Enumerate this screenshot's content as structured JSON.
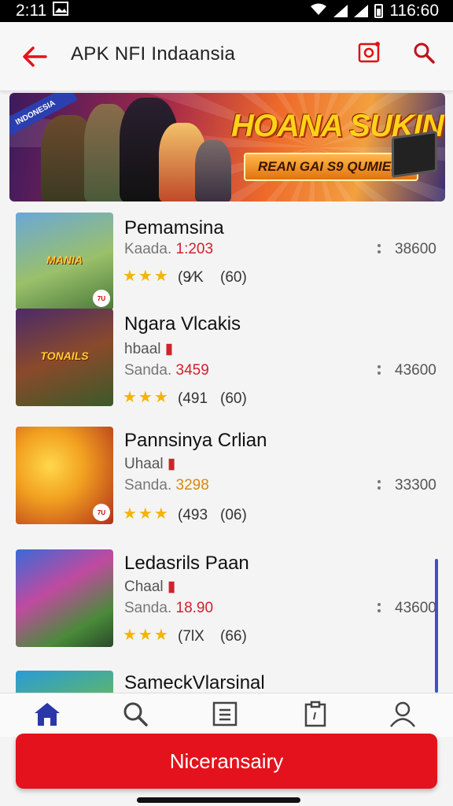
{
  "status_bar": {
    "time": "2:11",
    "right_time": "116:60"
  },
  "header": {
    "title": "APK NFI  Indaansia",
    "back_icon": "back-arrow-icon",
    "camera_icon": "camera-icon",
    "search_icon": "search-icon"
  },
  "banner": {
    "corner_text": "INDONESIA",
    "title": "HOANA SUKIN",
    "subtitle": "REAN GAI S9 QUMIEB."
  },
  "apps": [
    {
      "title": "Pemamsina",
      "developer": "",
      "meta_label": "Kaada.",
      "size": "1:203",
      "size_color": "red",
      "rating_count": "(9⁄K",
      "rating_total": "(60)",
      "downloads": "38600",
      "thumb_label": "MANIA",
      "badge": "7U"
    },
    {
      "title": "Ngara Vlcakis",
      "developer": "hbaal",
      "meta_label": "Sanda.",
      "size": "3459",
      "size_color": "red",
      "rating_count": "(491",
      "rating_total": "(60)",
      "downloads": "43600",
      "thumb_label": "TONAILS",
      "badge": ""
    },
    {
      "title": "Pannsinya Crlian",
      "developer": "Uhaal",
      "meta_label": "Sanda.",
      "size": "3298",
      "size_color": "orange",
      "rating_count": "(493",
      "rating_total": "(06)",
      "downloads": "33300",
      "thumb_label": "",
      "badge": "7U"
    },
    {
      "title": "Ledasrils Paan",
      "developer": "Chaal",
      "meta_label": "Sanda.",
      "size": "18.90",
      "size_color": "red",
      "rating_count": "(7lX",
      "rating_total": "(66)",
      "downloads": "43600",
      "thumb_label": "",
      "badge": ""
    },
    {
      "title": "SameckVlarsinal",
      "developer": "",
      "meta_label": "",
      "size": "",
      "size_color": "red",
      "rating_count": "",
      "rating_total": "",
      "downloads": "",
      "thumb_label": "",
      "badge": ""
    }
  ],
  "stars_text": "★★★",
  "bottom_nav": [
    {
      "name": "home",
      "icon": "home-icon",
      "active": true
    },
    {
      "name": "search",
      "icon": "search-icon",
      "active": false
    },
    {
      "name": "list",
      "icon": "list-icon",
      "active": false
    },
    {
      "name": "clipboard",
      "icon": "clipboard-icon",
      "active": false
    },
    {
      "name": "profile",
      "icon": "profile-icon",
      "active": false
    }
  ],
  "cta": {
    "label": "Niceransairy"
  },
  "colors": {
    "accent": "#e3121c",
    "nav_active": "#2a37a8",
    "star": "#f2b500"
  }
}
